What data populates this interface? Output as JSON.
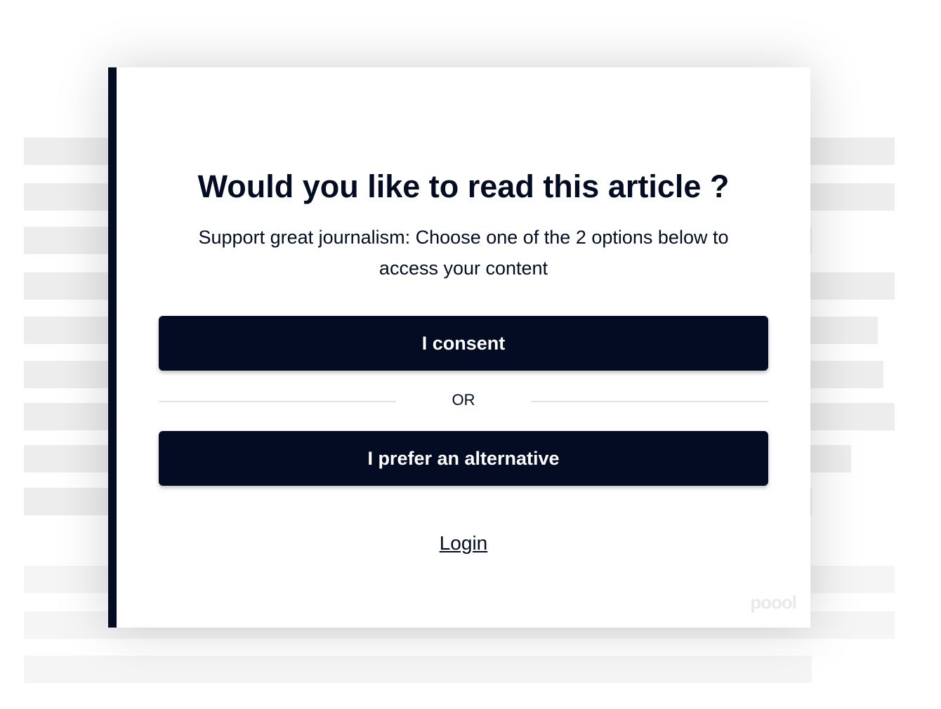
{
  "modal": {
    "title": "Would you like to read this article ?",
    "subtitle": "Support great journalism: Choose one of the 2 options below to access your content",
    "consent_label": "I consent",
    "divider_label": "OR",
    "alternative_label": "I prefer an alternative",
    "login_label": "Login",
    "brand_logo": "poool"
  },
  "colors": {
    "accent": "#030c22",
    "placeholder": "#ededed"
  }
}
